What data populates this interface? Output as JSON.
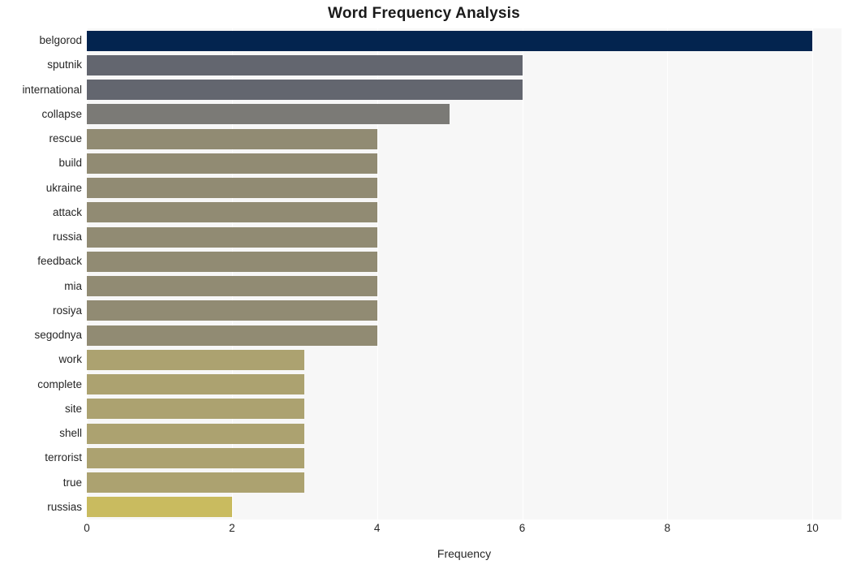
{
  "chart_data": {
    "type": "bar",
    "orientation": "horizontal",
    "title": "Word Frequency Analysis",
    "xlabel": "Frequency",
    "ylabel": "",
    "xlim": [
      0,
      10.4
    ],
    "xticks": [
      0,
      2,
      4,
      6,
      8,
      10
    ],
    "xtick_labels": [
      "0",
      "2",
      "4",
      "6",
      "8",
      "10"
    ],
    "grid": "vertical-white",
    "legend": "none",
    "categories": [
      "belgorod",
      "sputnik",
      "international",
      "collapse",
      "rescue",
      "build",
      "ukraine",
      "attack",
      "russia",
      "feedback",
      "mia",
      "rosiya",
      "segodnya",
      "work",
      "complete",
      "site",
      "shell",
      "terrorist",
      "true",
      "russias"
    ],
    "values": [
      10,
      6,
      6,
      5,
      4,
      4,
      4,
      4,
      4,
      4,
      4,
      4,
      4,
      3,
      3,
      3,
      3,
      3,
      3,
      2
    ],
    "bar_colors": [
      "#03244f",
      "#63666f",
      "#63666f",
      "#7b7a76",
      "#918b73",
      "#918b73",
      "#918b73",
      "#918b73",
      "#918b73",
      "#918b73",
      "#918b73",
      "#918b73",
      "#918b73",
      "#aca270",
      "#aca270",
      "#aca270",
      "#aca270",
      "#aca270",
      "#aca270",
      "#c9bb5f"
    ],
    "plot_background": "#f7f7f7",
    "figure_background": "#ffffff"
  }
}
